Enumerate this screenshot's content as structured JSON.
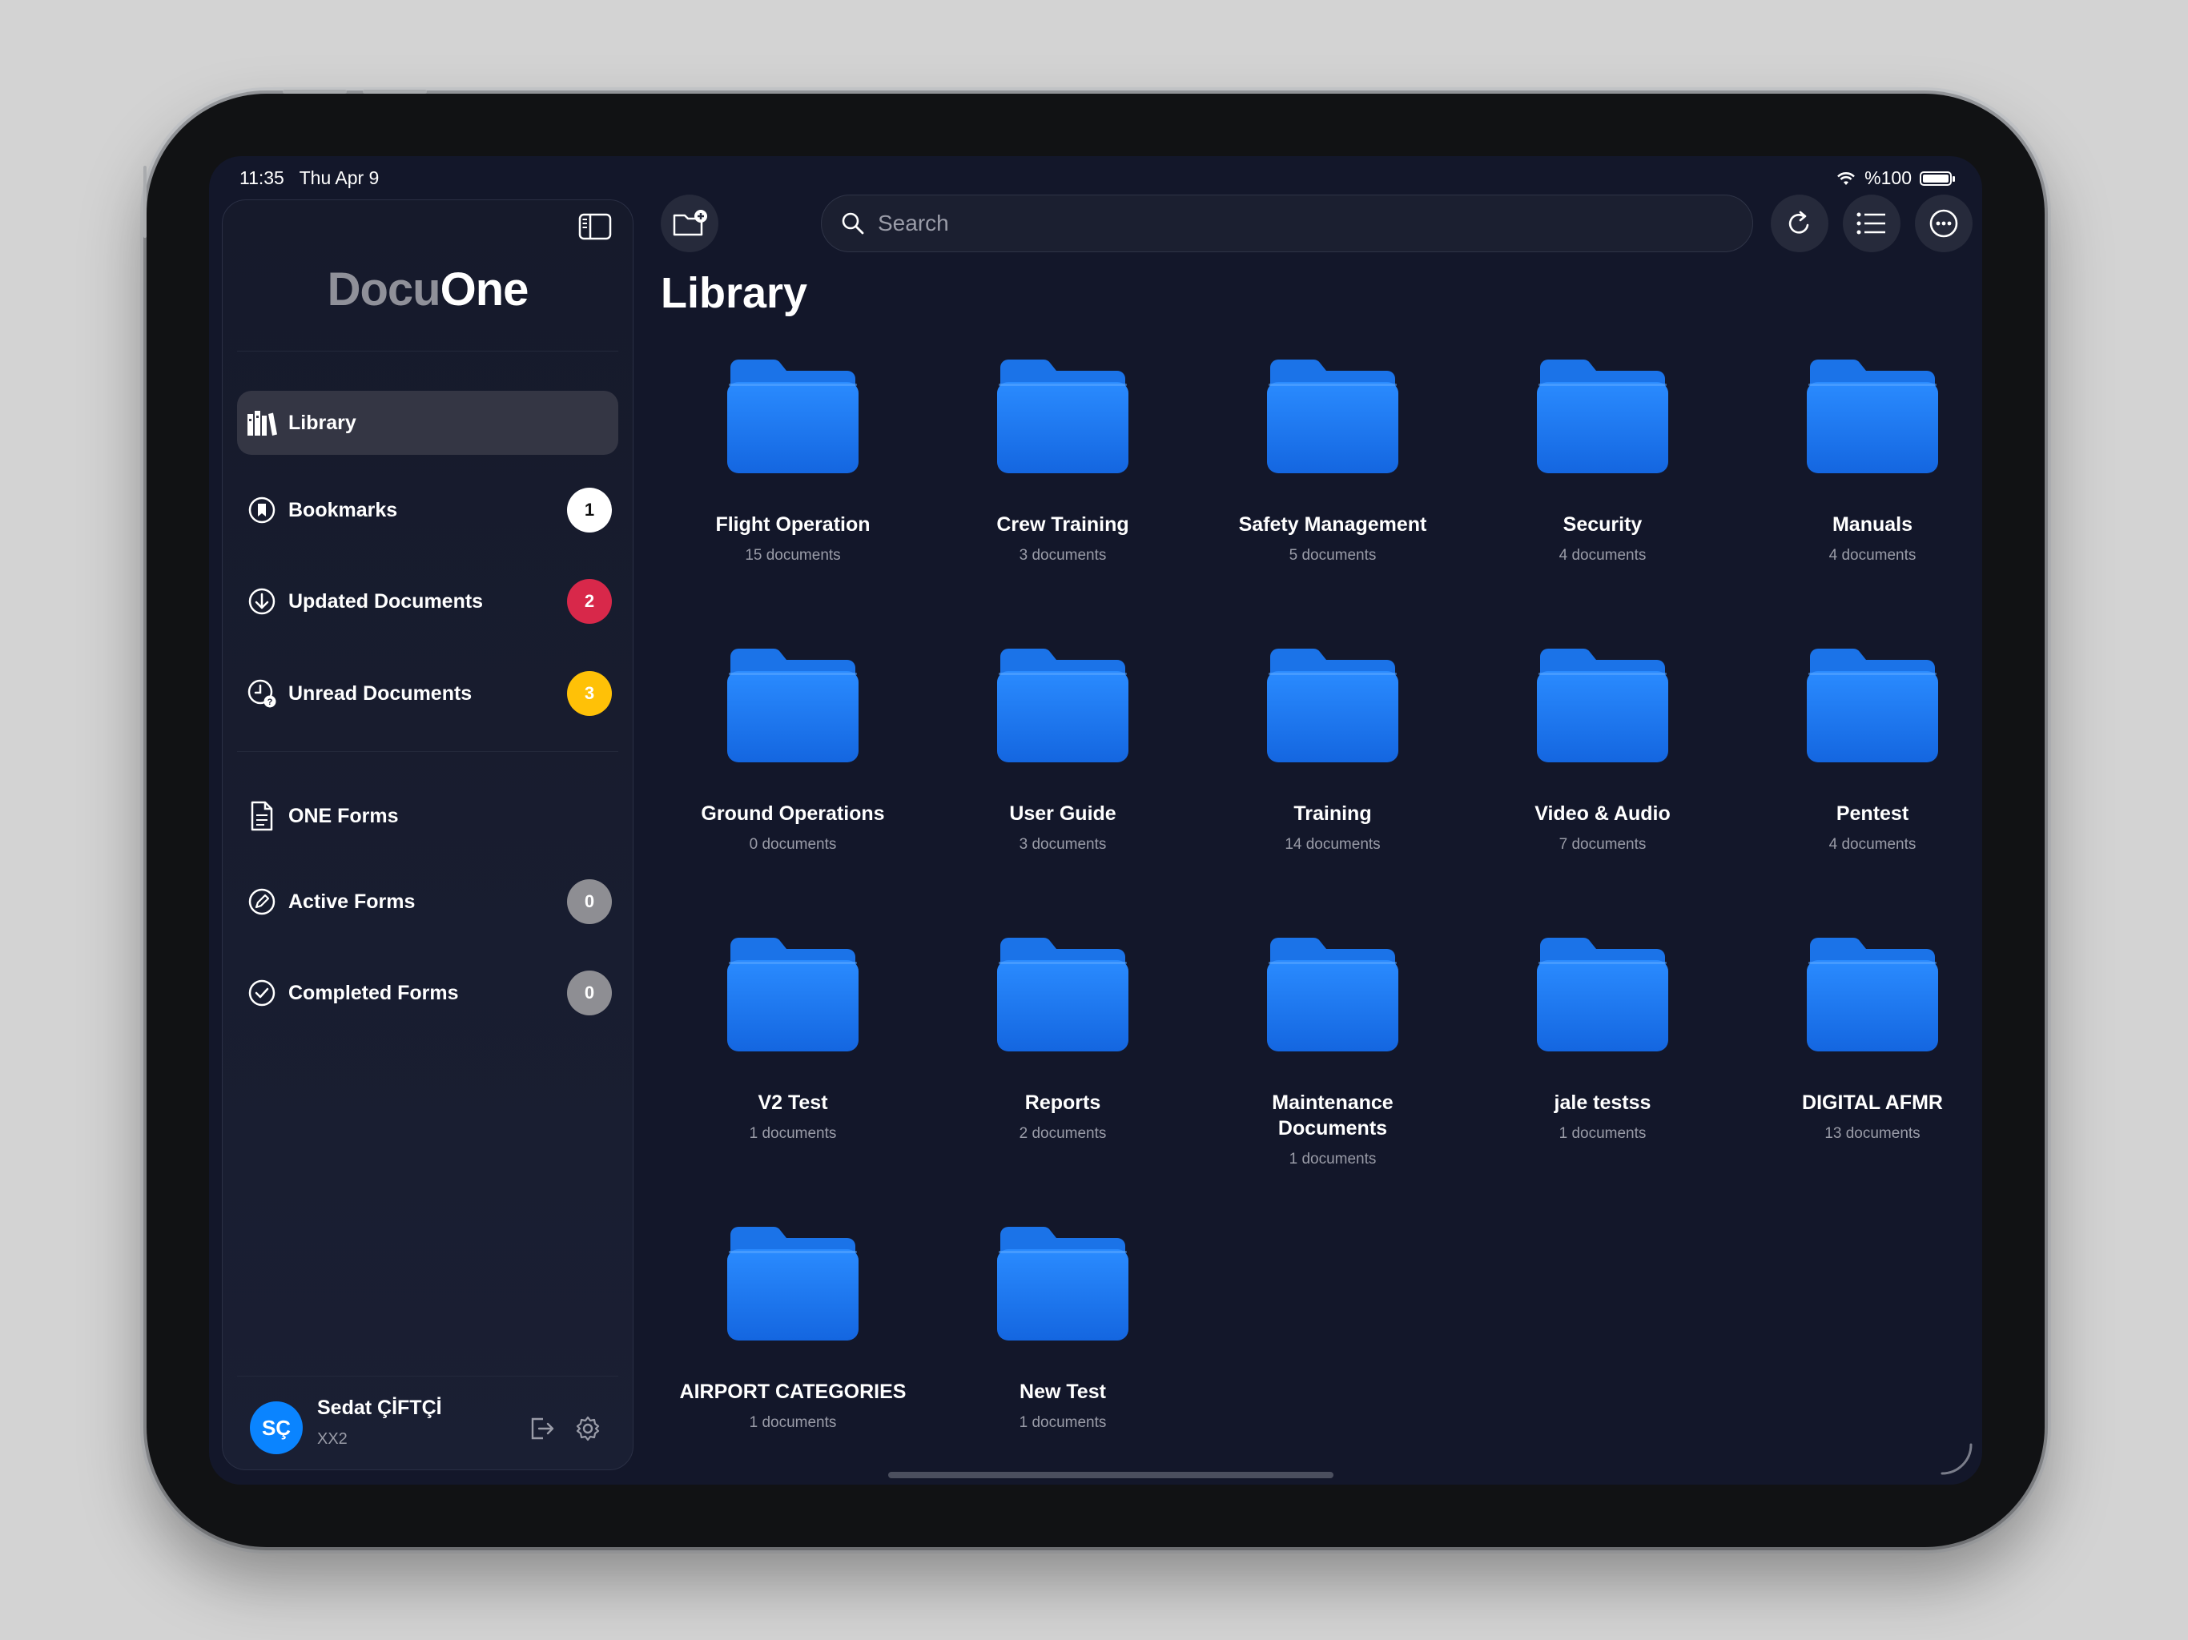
{
  "status_bar": {
    "time": "11:35",
    "date": "Thu Apr 9",
    "battery": "%100",
    "battery_level": 1.0
  },
  "sidebar": {
    "logo_part1": "Docu",
    "logo_part2": "One",
    "items": [
      {
        "label": "Library",
        "icon": "library-icon",
        "active": true
      },
      {
        "label": "Bookmarks",
        "icon": "bookmark-icon",
        "badge": "1",
        "badge_color": "#ffffff"
      },
      {
        "label": "Updated Documents",
        "icon": "download-circle-icon",
        "badge": "2",
        "badge_color": "#d8284a"
      },
      {
        "label": "Unread Documents",
        "icon": "clock-alert-icon",
        "badge": "3",
        "badge_color": "#ffc107"
      },
      {
        "label": "ONE Forms",
        "icon": "document-icon"
      },
      {
        "label": "Active Forms",
        "icon": "pencil-circle-icon",
        "badge": "0",
        "badge_color": "#8e8e93"
      },
      {
        "label": "Completed Forms",
        "icon": "check-circle-icon",
        "badge": "0",
        "badge_color": "#8e8e93"
      }
    ],
    "user": {
      "initials": "SÇ",
      "name": "Sedat ÇİFTÇİ",
      "subtitle": "XX2"
    }
  },
  "toolbar": {
    "search_placeholder": "Search"
  },
  "page_title": "Library",
  "folders": [
    {
      "name": "Flight Operation",
      "count": "15 documents"
    },
    {
      "name": "Crew Training",
      "count": "3 documents"
    },
    {
      "name": "Safety Management",
      "count": "5 documents"
    },
    {
      "name": "Security",
      "count": "4 documents"
    },
    {
      "name": "Manuals",
      "count": "4 documents"
    },
    {
      "name": "Ground Operations",
      "count": "0 documents"
    },
    {
      "name": "User Guide",
      "count": "3 documents"
    },
    {
      "name": "Training",
      "count": "14 documents"
    },
    {
      "name": "Video & Audio",
      "count": "7 documents"
    },
    {
      "name": "Pentest",
      "count": "4 documents"
    },
    {
      "name": "V2 Test",
      "count": "1 documents"
    },
    {
      "name": "Reports",
      "count": "2 documents"
    },
    {
      "name": "Maintenance Documents",
      "count": "1 documents"
    },
    {
      "name": "jale testss",
      "count": "1 documents"
    },
    {
      "name": "DIGITAL AFMR",
      "count": "13 documents"
    },
    {
      "name": "AIRPORT CATEGORIES",
      "count": "1 documents"
    },
    {
      "name": "New Test",
      "count": "1 documents"
    }
  ],
  "colors": {
    "accent": "#0a84ff",
    "folder": "#1a7cf0",
    "background": "#13172a",
    "sidebar_active": "#343644"
  }
}
